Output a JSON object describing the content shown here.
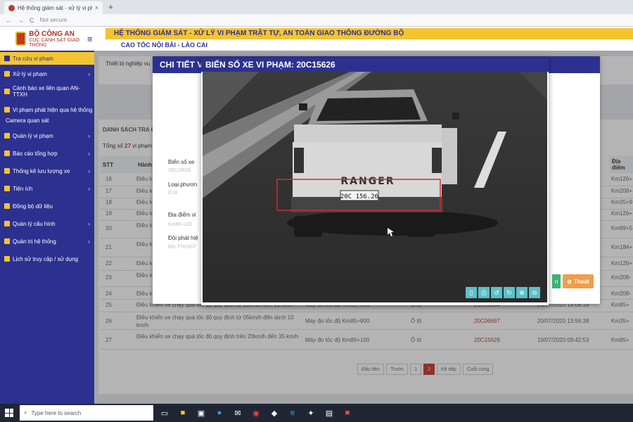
{
  "browser": {
    "tab_title": "Hệ thống giám sát - xử lý vi phạ",
    "tab_close": "×",
    "new_tab": "+",
    "back": "←",
    "forward": "→",
    "reload": "C",
    "not_secure": "Not secure"
  },
  "header": {
    "org": "BỘ CÔNG AN",
    "dept": "CỤC CẢNH SÁT GIAO THÔNG",
    "title": "HỆ THỐNG GIÁM SÁT - XỬ LÝ VI PHẠM TRẬT TỰ, AN TOÀN GIAO THÔNG ĐƯỜNG BỘ",
    "subtitle": "CAO TỐC NỘI BÀI - LÀO CAI",
    "menu_icon": "≡"
  },
  "sidebar": {
    "items": [
      {
        "label": "Tra cứu vi phạm",
        "chevron": ""
      },
      {
        "label": "Xử lý vi phạm",
        "chevron": "›"
      },
      {
        "label": "Cảnh báo xe liên quan AN-TTXH",
        "chevron": ""
      },
      {
        "label": "Vi phạm phát hiện qua hệ thống",
        "chevron": ""
      },
      {
        "label": "Camera quan sát",
        "chevron": ""
      },
      {
        "label": "Quản lý vi phạm",
        "chevron": "›"
      },
      {
        "label": "Báo cáo tổng hợp",
        "chevron": "›"
      },
      {
        "label": "Thống kê lưu lượng xe",
        "chevron": "›"
      },
      {
        "label": "Tiện ích",
        "chevron": "›"
      },
      {
        "label": "Đồng bộ dữ liệu",
        "chevron": ""
      },
      {
        "label": "Quản lý cấu hình",
        "chevron": "›"
      },
      {
        "label": "Quản trị hệ thống",
        "chevron": "›"
      },
      {
        "label": "Lịch sử truy cập / sử dụng",
        "chevron": ""
      }
    ]
  },
  "main": {
    "panel_label": "Thiết bị nghiệp vụ",
    "list_title": "DANH SÁCH TRA C",
    "total_prefix": "Tổng số",
    "total_count": "27",
    "total_suffix": "vi phạm",
    "columns": [
      "STT",
      "Hành",
      "Địa điểm"
    ],
    "rows": [
      {
        "stt": "16",
        "desc": "Điều k",
        "type": "",
        "vehicle": "",
        "plate": "",
        "time": "",
        "loc": "Km126+"
      },
      {
        "stt": "17",
        "desc": "Điều k",
        "type": "",
        "vehicle": "",
        "plate": "",
        "time": "",
        "loc": "Km208+"
      },
      {
        "stt": "18",
        "desc": "Điều k",
        "type": "",
        "vehicle": "",
        "plate": "",
        "time": "",
        "loc": "Km35+9"
      },
      {
        "stt": "19",
        "desc": "Điều k",
        "type": "",
        "vehicle": "",
        "plate": "",
        "time": "",
        "loc": "Km126+"
      },
      {
        "stt": "20",
        "desc": "Điều k",
        "type": "",
        "vehicle": "",
        "plate": "",
        "time": "",
        "loc": "Km69+5"
      },
      {
        "stt": "21",
        "desc": "Điều k",
        "type": "",
        "vehicle": "",
        "plate": "",
        "time": "",
        "loc": "Km184+"
      },
      {
        "stt": "22",
        "desc": "Điều k",
        "type": "",
        "vehicle": "",
        "plate": "",
        "time": "",
        "loc": "Km126+"
      },
      {
        "stt": "23",
        "desc": "Điều k",
        "type": "",
        "vehicle": "",
        "plate": "",
        "time": "",
        "loc": "Km208-"
      },
      {
        "stt": "24",
        "desc": "Điều khiển xe chạy quá",
        "type": "",
        "vehicle": "",
        "plate": "",
        "time": "",
        "loc": "Km208-"
      },
      {
        "stt": "25",
        "desc": "Điều khiển xe chạy quá tốc độ quy định từ 10km/h đến 20 km/h",
        "type": "Máy đo tốc độ Km85+900",
        "vehicle": "Ô tô",
        "plate": "20C16144",
        "time": "23/07/2020 14:08:18",
        "loc": "Km85+"
      },
      {
        "stt": "26",
        "desc": "Điều khiển xe chạy quá tốc độ quy định từ 05km/h đến dưới 10 km/h",
        "type": "Máy đo tốc độ Km85+900",
        "vehicle": "Ô tô",
        "plate": "20C06697",
        "time": "20/07/2020 13:56:38",
        "loc": "Km35+"
      },
      {
        "stt": "27",
        "desc": "Điều khiển xe chạy quá tốc độ quy định trên 20km/h đến 35 km/h",
        "type": "Máy đo tốc độ Km85+100",
        "vehicle": "Ô tô",
        "plate": "20C15626",
        "time": "19/07/2020 09:42:53",
        "loc": "Km85+"
      }
    ],
    "pager": [
      "Đầu tiên",
      "Trước",
      "1",
      "2",
      "Kế tiếp",
      "Cuối cùng"
    ]
  },
  "detail_modal": {
    "title": "CHI TIẾT VI",
    "fields": [
      {
        "label": "Biển số xe",
        "value": "20C15626"
      },
      {
        "label": "Loại phươn",
        "value": "Ô tô"
      },
      {
        "label": "Địa điểm vi",
        "value": "Km85+100"
      },
      {
        "label": "Đội phát hiệ",
        "value": "Đội TTKSGT"
      }
    ],
    "exit_label": "Thoát",
    "green_label": "n"
  },
  "plate_modal": {
    "title": "BIỂN SỐ XE VI PHẠM: 20C15626",
    "plate_text": "20C 156.26",
    "truck_text": "RANGER",
    "tools": [
      "file-icon",
      "print-icon",
      "rotate-left-icon",
      "rotate-right-icon",
      "zoom-in-icon",
      "zoom-out-icon"
    ]
  },
  "taskbar": {
    "search_placeholder": "Type here to search"
  },
  "colors": {
    "navy": "#2c3190",
    "yellow": "#f4c430",
    "red": "#c0392b",
    "orange": "#f39c4b",
    "teal": "#5bc0c8"
  }
}
